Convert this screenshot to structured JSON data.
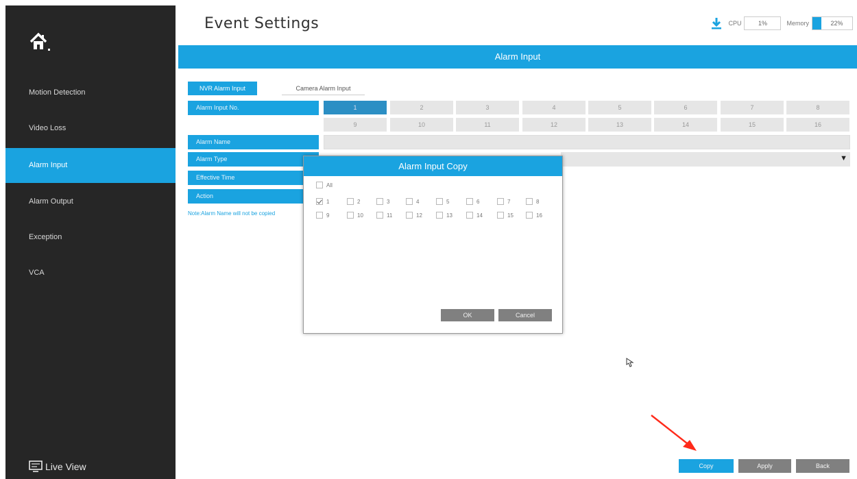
{
  "header": {
    "title": "Event Settings",
    "cpu_label": "CPU",
    "cpu_value": "1%",
    "memory_label": "Memory",
    "memory_value": "22%",
    "memory_fraction": 0.22,
    "download_icon": "download-icon"
  },
  "sidebar": {
    "home_icon": "home-icon",
    "items": [
      {
        "label": "Motion Detection"
      },
      {
        "label": "Video Loss"
      },
      {
        "label": "Alarm Input"
      },
      {
        "label": "Alarm Output"
      },
      {
        "label": "Exception"
      },
      {
        "label": "VCA"
      }
    ],
    "active_index": 2,
    "live_view_label": "Live View"
  },
  "banner": {
    "title": "Alarm Input"
  },
  "tabs": {
    "nvr": "NVR Alarm Input",
    "camera": "Camera Alarm Input"
  },
  "form": {
    "input_no_label": "Alarm Input No.",
    "channels": [
      "1",
      "2",
      "3",
      "4",
      "5",
      "6",
      "7",
      "8",
      "9",
      "10",
      "11",
      "12",
      "13",
      "14",
      "15",
      "16"
    ],
    "selected_channel": "1",
    "alarm_name_label": "Alarm Name",
    "alarm_name_value": "",
    "alarm_type_label": "Alarm Type",
    "alarm_type_value": "",
    "effective_time_label": "Effective Time",
    "action_label": "Action",
    "note": "Note:Alarm Name will not be copied"
  },
  "modal": {
    "title": "Alarm Input Copy",
    "all_label": "All",
    "options": [
      {
        "label": "1",
        "checked": true
      },
      {
        "label": "2",
        "checked": false
      },
      {
        "label": "3",
        "checked": false
      },
      {
        "label": "4",
        "checked": false
      },
      {
        "label": "5",
        "checked": false
      },
      {
        "label": "6",
        "checked": false
      },
      {
        "label": "7",
        "checked": false
      },
      {
        "label": "8",
        "checked": false
      },
      {
        "label": "9",
        "checked": false
      },
      {
        "label": "10",
        "checked": false
      },
      {
        "label": "11",
        "checked": false
      },
      {
        "label": "12",
        "checked": false
      },
      {
        "label": "13",
        "checked": false
      },
      {
        "label": "14",
        "checked": false
      },
      {
        "label": "15",
        "checked": false
      },
      {
        "label": "16",
        "checked": false
      }
    ],
    "ok_label": "OK",
    "cancel_label": "Cancel"
  },
  "buttons": {
    "copy": "Copy",
    "apply": "Apply",
    "back": "Back"
  },
  "colors": {
    "accent": "#1aa3e0",
    "sidebar_bg": "#262626",
    "button_gray": "#808080",
    "annotation_red": "#ff2a1a"
  }
}
